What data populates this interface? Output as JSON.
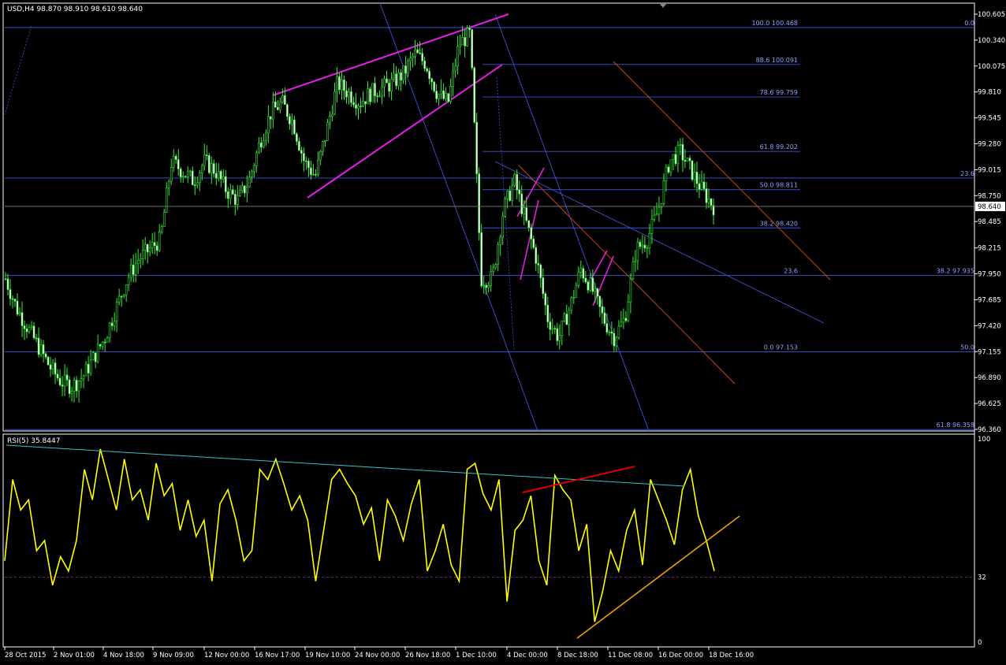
{
  "header": {
    "title": "USD,H4  98.870 98.910 98.610 98.640",
    "rsi_title": "RSI(5) 35.8447"
  },
  "colors": {
    "background": "#000000",
    "frame": "#ffffff",
    "bull_candle": "#33ee33",
    "fib_line": "#3f52d6",
    "fib_text": "#8da2ff",
    "channel_wedge": "#e61ee6",
    "orange_trend": "#d84a18",
    "blue_trend": "#3f52d6",
    "rsi_line": "#ffff00",
    "rsi_support": "#f0a000",
    "rsi_divergence_red": "#e00000",
    "rsi_top_trend": "#3fbfbf",
    "rsi_level_32": "#7a2a8a",
    "price_tag_bg": "#ffffff",
    "price_tag_text": "#000000"
  },
  "chart_data": [
    {
      "type": "candlestick",
      "symbol": "USD",
      "timeframe": "H4",
      "ohlc_current": {
        "open": 98.87,
        "high": 98.91,
        "low": 98.61,
        "close": 98.64
      },
      "current_price_label": "98.640",
      "yticks": [
        "100.605",
        "100.340",
        "100.075",
        "99.810",
        "99.545",
        "99.280",
        "99.015",
        "98.750",
        "98.485",
        "98.215",
        "97.950",
        "97.685",
        "97.420",
        "97.155",
        "96.890",
        "96.625",
        "96.360"
      ],
      "ylim": [
        96.36,
        100.605
      ],
      "xticks": [
        "28 Oct 2015",
        "2 Nov 01:00",
        "4 Nov 18:00",
        "9 Nov 09:00",
        "12 Nov 00:00",
        "16 Nov 17:00",
        "19 Nov 10:00",
        "24 Nov 00:00",
        "26 Nov 18:00",
        "1 Dec 10:00",
        "4 Dec 00:00",
        "8 Dec 18:00",
        "11 Dec 08:00",
        "16 Dec 00:00",
        "18 Dec 16:00"
      ],
      "close_path_approx": [
        97.9,
        97.6,
        97.4,
        97.2,
        97.0,
        96.85,
        96.8,
        96.9,
        97.1,
        97.3,
        97.6,
        97.9,
        98.1,
        98.2,
        98.3,
        99.1,
        99.0,
        98.9,
        99.1,
        99.0,
        98.8,
        98.7,
        98.9,
        99.3,
        99.6,
        99.7,
        99.5,
        99.1,
        98.95,
        99.4,
        99.9,
        99.8,
        99.7,
        99.8,
        99.85,
        99.9,
        100.0,
        100.2,
        100.1,
        99.8,
        99.7,
        100.3,
        100.4,
        97.9,
        97.9,
        98.6,
        98.9,
        98.5,
        98.1,
        97.5,
        97.3,
        97.6,
        98.0,
        97.8,
        97.5,
        97.3,
        97.5,
        98.2,
        98.3,
        98.6,
        99.1,
        99.2,
        99.0,
        98.8,
        98.64
      ],
      "fib_levels_left": [
        {
          "label": "100.0 100.468",
          "price": 100.468
        },
        {
          "label": "88.6 100.091",
          "price": 100.091
        },
        {
          "label": "78.6 99.759",
          "price": 99.759
        },
        {
          "label": "61.8 99.202",
          "price": 99.202
        },
        {
          "label": "50.0 98.811",
          "price": 98.811
        },
        {
          "label": "38.2 98.420",
          "price": 98.42
        },
        {
          "label": "23.6",
          "price": 97.935
        },
        {
          "label": "0.0 97.153",
          "price": 97.153
        }
      ],
      "fib_levels_right": [
        {
          "label": "0.0",
          "price": 100.468
        },
        {
          "label": "23.6",
          "price": 98.93
        },
        {
          "label": "38.2 97.935",
          "price": 97.935
        },
        {
          "label": "50.0",
          "price": 97.153
        },
        {
          "label": "61.8 96.358",
          "price": 96.358
        }
      ]
    },
    {
      "type": "line",
      "indicator": "RSI",
      "period": 5,
      "current_value": 35.8447,
      "yticks": [
        "100",
        "32",
        "0"
      ],
      "ylim": [
        0,
        100
      ],
      "level_line": 32,
      "values_approx": [
        40,
        80,
        65,
        70,
        45,
        50,
        28,
        42,
        35,
        50,
        85,
        70,
        95,
        80,
        65,
        90,
        70,
        75,
        60,
        88,
        72,
        78,
        55,
        70,
        52,
        60,
        30,
        68,
        75,
        60,
        40,
        45,
        85,
        80,
        90,
        78,
        65,
        72,
        60,
        30,
        55,
        80,
        85,
        78,
        72,
        58,
        66,
        40,
        70,
        62,
        50,
        68,
        80,
        35,
        45,
        58,
        38,
        30,
        85,
        88,
        73,
        65,
        80,
        20,
        55,
        60,
        72,
        40,
        28,
        82,
        75,
        70,
        45,
        58,
        10,
        25,
        45,
        35,
        55,
        65,
        38,
        80,
        70,
        60,
        48,
        75,
        85,
        62,
        50,
        35
      ]
    }
  ]
}
